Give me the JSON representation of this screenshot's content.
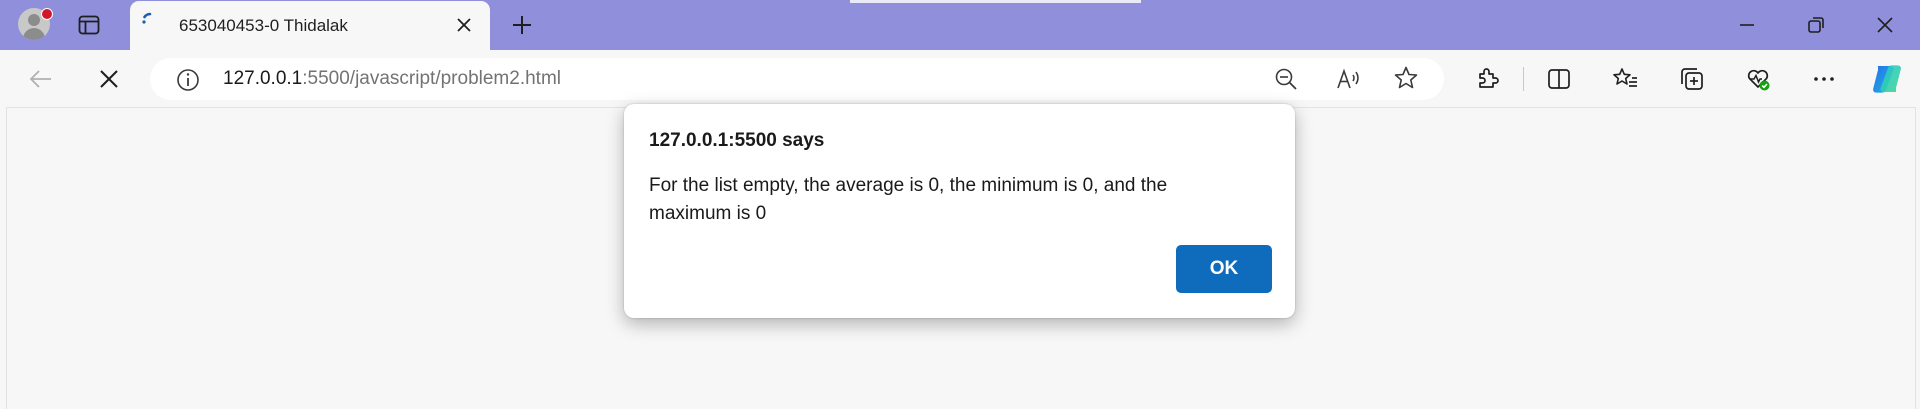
{
  "tab": {
    "title": "653040453-0 Thidalak"
  },
  "address_bar": {
    "host": "127.0.0.1",
    "rest": ":5500/javascript/problem2.html"
  },
  "dialog": {
    "title": "127.0.0.1:5500 says",
    "message": "For the list empty, the average is 0, the minimum is 0, and the maximum is 0",
    "ok_label": "OK"
  },
  "colors": {
    "titlebar": "#8f8fdb",
    "ok_button": "#0f6cbd",
    "profile_notification": "#d1182b",
    "health_badge": "#13a10e"
  },
  "icons": {
    "titlebar": [
      "profile-avatar",
      "tab-actions-icon",
      "loading-spinner-icon",
      "close-tab-icon",
      "new-tab-icon",
      "minimize-icon",
      "restore-icon",
      "close-window-icon"
    ],
    "toolbar": [
      "back-arrow-icon",
      "stop-loading-icon",
      "site-info-icon",
      "zoom-out-icon",
      "read-aloud-icon",
      "add-favorite-icon",
      "extensions-icon",
      "split-screen-icon",
      "favorites-icon",
      "collections-icon",
      "browser-essentials-icon",
      "more-menu-icon",
      "copilot-icon"
    ]
  }
}
